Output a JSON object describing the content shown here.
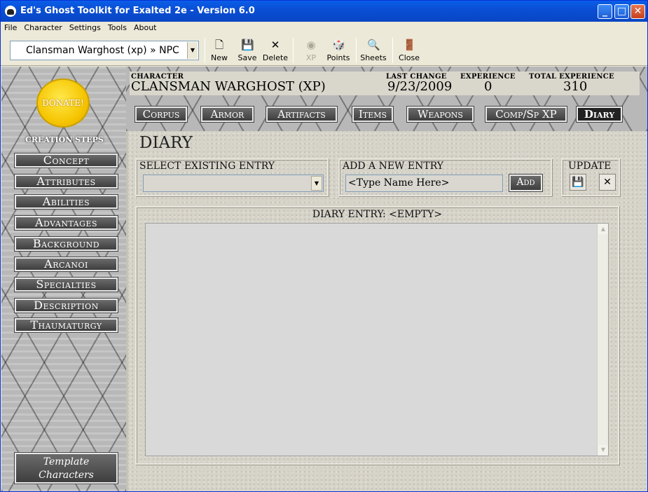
{
  "window": {
    "title": "Ed's Ghost Toolkit for Exalted 2e - Version 6.0"
  },
  "menu": [
    "File",
    "Character",
    "Settings",
    "Tools",
    "About"
  ],
  "toolbar": {
    "character_select": "Clansman Warghost (xp) » NPC",
    "buttons": {
      "new": "New",
      "save": "Save",
      "delete": "Delete",
      "xp": "XP",
      "points": "Points",
      "sheets": "Sheets",
      "close": "Close"
    }
  },
  "sidebar": {
    "donate": "DONATE!",
    "creation_steps": "Creation Steps",
    "steps": [
      "Concept",
      "Attributes",
      "Abilities",
      "Advantages",
      "Background",
      "Arcanoi",
      "Specialties",
      "Description",
      "Thaumaturgy"
    ],
    "template_line1": "Template",
    "template_line2": "Characters"
  },
  "header": {
    "character_label": "Character",
    "character_name": "Clansman Warghost (xp)",
    "last_change_label": "Last Change",
    "last_change": "9/23/2009",
    "experience_label": "Experience",
    "experience": "0",
    "total_label": "Total Experience",
    "total": "310",
    "tabs": [
      "Corpus",
      "Armor",
      "Artifacts",
      "Items",
      "Weapons",
      "Comp/Sp XP",
      "Diary"
    ]
  },
  "diary": {
    "title": "Diary",
    "select_label": "Select Existing Entry",
    "select_value": "",
    "add_label": "Add a New Entry",
    "name_placeholder": "<Type Name Here>",
    "add_button": "Add",
    "update_label": "Update",
    "entry_label": "Diary Entry: <EMPTY>",
    "entry_text": ""
  }
}
